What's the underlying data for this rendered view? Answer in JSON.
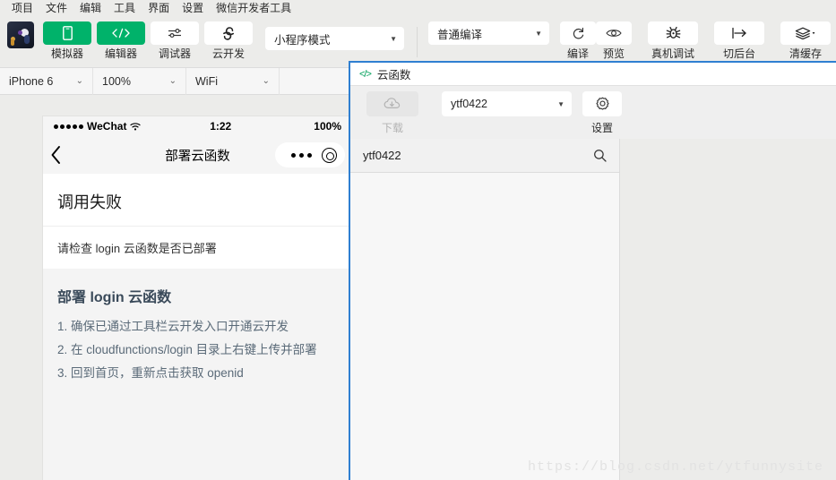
{
  "menubar": {
    "items": [
      {
        "label": "项目"
      },
      {
        "label": "文件"
      },
      {
        "label": "编辑"
      },
      {
        "label": "工具"
      },
      {
        "label": "界面"
      },
      {
        "label": "设置"
      },
      {
        "label": "微信开发者工具"
      }
    ]
  },
  "toolbar": {
    "left_buttons": [
      {
        "label": "模拟器",
        "icon": "phone-icon",
        "active": true
      },
      {
        "label": "编辑器",
        "icon": "code-icon",
        "active": true
      },
      {
        "label": "调试器",
        "icon": "sliders-icon",
        "active": false
      },
      {
        "label": "云开发",
        "icon": "cloud-icon",
        "active": false
      }
    ],
    "mode_select": {
      "value": "小程序模式",
      "caret": "chevron-down-icon"
    },
    "compile_select": {
      "value": "普通编译",
      "caret": "chevron-down-icon"
    },
    "right_buttons": [
      {
        "label": "编译",
        "icon": "refresh-icon"
      },
      {
        "label": "预览",
        "icon": "eye-icon"
      },
      {
        "label": "真机调试",
        "icon": "bug-icon"
      },
      {
        "label": "切后台",
        "icon": "arrow-to-right-icon"
      },
      {
        "label": "清缓存",
        "icon": "layers-icon"
      }
    ]
  },
  "devicebar": {
    "device": "iPhone 6",
    "zoom": "100%",
    "network": "WiFi"
  },
  "simulator": {
    "status_bar": {
      "carrier": "WeChat",
      "wifi": "wifi-icon",
      "time": "1:22",
      "battery": "100%"
    },
    "nav": {
      "back": "back-chevron-icon",
      "title": "部署云函数",
      "menu": "capsule-more-icon",
      "close": "capsule-target-icon"
    },
    "card": {
      "title": "调用失败",
      "desc": "请检查 login 云函数是否已部署"
    },
    "tips": {
      "heading": "部署 login 云函数",
      "lines": [
        "1. 确保已通过工具栏云开发入口开通云开发",
        "2. 在 cloudfunctions/login 目录上右键上传并部署",
        "3. 回到首页，重新点击获取 openid"
      ]
    }
  },
  "cloud_panel": {
    "header": {
      "icon": "code-brackets-icon",
      "title": "云函数"
    },
    "toolbar": {
      "download": {
        "label": "下载",
        "icon": "cloud-download-icon",
        "enabled": false
      },
      "env_select": {
        "value": "ytf0422",
        "caret": "chevron-down-icon"
      },
      "settings": {
        "label": "设置",
        "icon": "gear-icon"
      }
    },
    "search": {
      "value": "ytf0422",
      "placeholder": "搜索",
      "icon": "search-icon"
    }
  },
  "watermark": {
    "text": "https://blog.csdn.net/ytfunnysite"
  },
  "colors": {
    "accent_green": "#00b26a",
    "panel_border_blue": "#2f7fd1",
    "chrome_bg": "#ececea",
    "code_icon_green": "#00a05a"
  }
}
